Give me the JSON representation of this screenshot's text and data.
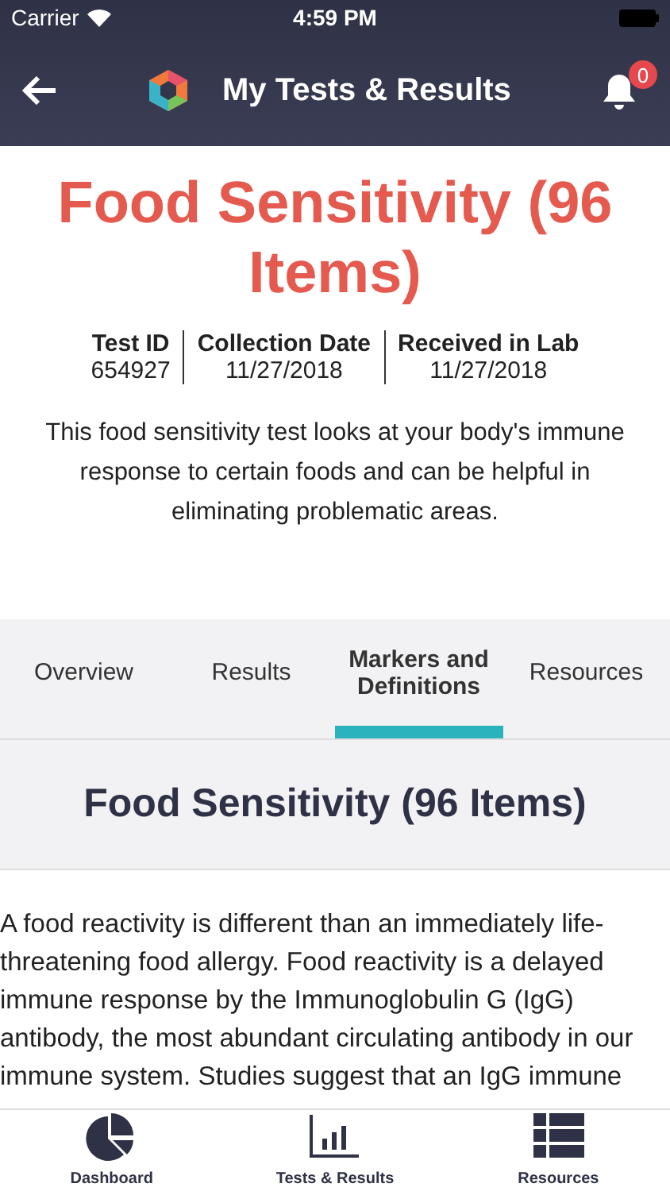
{
  "status_bar": {
    "carrier": "Carrier",
    "time": "4:59 PM"
  },
  "header": {
    "title": "My Tests & Results",
    "notification_count": "0"
  },
  "test": {
    "title": "Food Sensitivity (96 Items)",
    "meta": [
      {
        "label": "Test ID",
        "value": "654927"
      },
      {
        "label": "Collection Date",
        "value": "11/27/2018"
      },
      {
        "label": "Received in Lab",
        "value": "11/27/2018"
      }
    ],
    "description": "This food sensitivity test looks at your body's immune response to certain foods and can be helpful in eliminating problematic areas."
  },
  "tabs": [
    {
      "label": "Overview",
      "selected": false
    },
    {
      "label": "Results",
      "selected": false
    },
    {
      "label": "Markers and Definitions",
      "selected": true
    },
    {
      "label": "Resources",
      "selected": false
    }
  ],
  "section": {
    "heading": "Food Sensitivity (96 Items)",
    "body": "A food reactivity is different than an immediately life-threatening food allergy. Food reactivity is a delayed immune response by the Immunoglobulin G (IgG) antibody, the most abundant circulating antibody in our immune system. Studies suggest that an IgG immune"
  },
  "tab_bar": [
    {
      "label": "Dashboard",
      "kind": "dashboard"
    },
    {
      "label": "Tests & Results",
      "kind": "tests"
    },
    {
      "label": "Resources",
      "kind": "resources"
    }
  ]
}
